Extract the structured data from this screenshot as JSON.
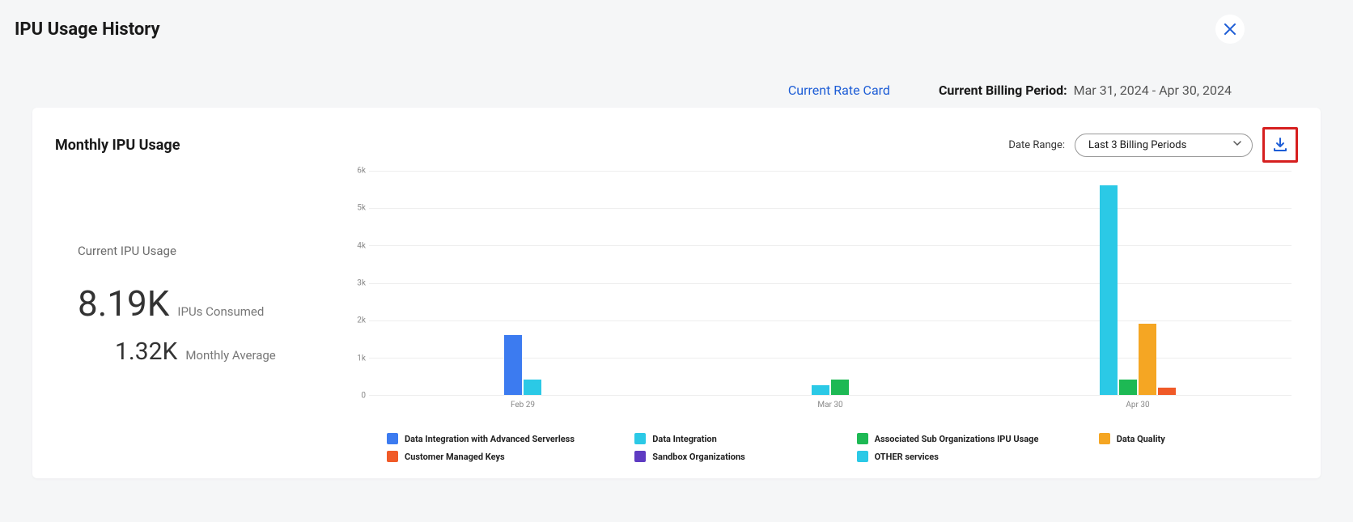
{
  "page": {
    "title": "IPU Usage History"
  },
  "top": {
    "rate_link": "Current Rate Card",
    "billing_label": "Current Billing Period:",
    "billing_value": "Mar 31, 2024 - Apr 30, 2024"
  },
  "card": {
    "title": "Monthly IPU Usage",
    "date_range_label": "Date Range:",
    "date_range_value": "Last 3 Billing Periods"
  },
  "stats": {
    "subhead": "Current IPU Usage",
    "consumed_value": "8.19K",
    "consumed_label": "IPUs Consumed",
    "avg_value": "1.32K",
    "avg_label": "Monthly Average"
  },
  "legend_items": [
    {
      "name": "Data Integration with Advanced Serverless",
      "color": "#3c7bf0"
    },
    {
      "name": "Data Integration",
      "color": "#2bc9e6"
    },
    {
      "name": "Associated Sub Organizations IPU Usage",
      "color": "#1db954"
    },
    {
      "name": "Data Quality",
      "color": "#f5a623"
    },
    {
      "name": "Customer Managed Keys",
      "color": "#f05a28"
    },
    {
      "name": "Sandbox Organizations",
      "color": "#5e3bc2"
    },
    {
      "name": "OTHER services",
      "color": "#2bc9e6"
    }
  ],
  "chart_data": {
    "type": "bar",
    "ylim": [
      0,
      6000
    ],
    "yticks": [
      0,
      1000,
      2000,
      3000,
      4000,
      5000,
      6000
    ],
    "ytick_labels": [
      "0",
      "1k",
      "2k",
      "3k",
      "4k",
      "5k",
      "6k"
    ],
    "categories": [
      "Feb 29",
      "Mar 30",
      "Apr 30"
    ],
    "series": [
      {
        "name": "Data Integration with Advanced Serverless",
        "color": "#3c7bf0",
        "values": [
          1600,
          0,
          0
        ]
      },
      {
        "name": "Data Integration",
        "color": "#2bc9e6",
        "values": [
          400,
          250,
          5600
        ]
      },
      {
        "name": "Associated Sub Organizations IPU Usage",
        "color": "#1db954",
        "values": [
          0,
          400,
          400
        ]
      },
      {
        "name": "Data Quality",
        "color": "#f5a623",
        "values": [
          0,
          0,
          1900
        ]
      },
      {
        "name": "Customer Managed Keys",
        "color": "#f05a28",
        "values": [
          0,
          0,
          200
        ]
      },
      {
        "name": "Sandbox Organizations",
        "color": "#5e3bc2",
        "values": [
          0,
          0,
          0
        ]
      },
      {
        "name": "OTHER services",
        "color": "#2bc9e6",
        "values": [
          0,
          0,
          0
        ]
      }
    ]
  }
}
